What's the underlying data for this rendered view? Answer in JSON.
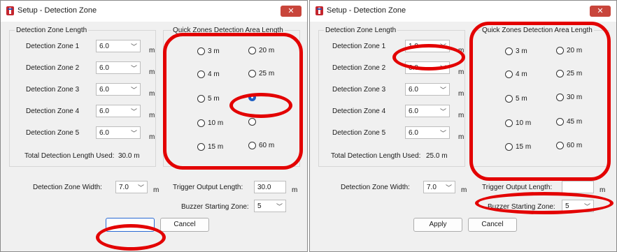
{
  "windows": [
    {
      "title": "Setup - Detection Zone",
      "close_glyph": "✕",
      "length_group": {
        "legend": "Detection Zone Length",
        "zones": [
          {
            "label": "Detection Zone 1",
            "value": "6.0"
          },
          {
            "label": "Detection Zone 2",
            "value": "6.0"
          },
          {
            "label": "Detection Zone 3",
            "value": "6.0"
          },
          {
            "label": "Detection Zone 4",
            "value": "6.0"
          },
          {
            "label": "Detection Zone 5",
            "value": "6.0"
          }
        ],
        "unit": "m",
        "total_label": "Total Detection Length Used:",
        "total_value": "30.0 m"
      },
      "quick_group": {
        "legend": "Quick Zones Detection Area Length",
        "options": [
          "3 m",
          "20 m",
          "4 m",
          "25 m",
          "5 m",
          "",
          "10 m",
          "",
          "15 m",
          "60 m"
        ],
        "checked_index": 5
      },
      "width_label": "Detection Zone Width:",
      "width_value": "7.0",
      "trigger_label": "Trigger Output Length:",
      "trigger_value": "30.0",
      "buzzer_label": "Buzzer Starting Zone:",
      "buzzer_value": "5",
      "apply_label": "",
      "cancel_label": "Cancel",
      "unit": "m"
    },
    {
      "title": "Setup - Detection Zone",
      "close_glyph": "✕",
      "length_group": {
        "legend": "Detection Zone Length",
        "zones": [
          {
            "label": "Detection Zone 1",
            "value": "1.0"
          },
          {
            "label": "Detection Zone 2",
            "value": "6.0"
          },
          {
            "label": "Detection Zone 3",
            "value": "6.0"
          },
          {
            "label": "Detection Zone 4",
            "value": "6.0"
          },
          {
            "label": "Detection Zone 5",
            "value": "6.0"
          }
        ],
        "unit": "m",
        "total_label": "Total Detection Length Used:",
        "total_value": "25.0 m"
      },
      "quick_group": {
        "legend": "Quick Zones Detection Area Length",
        "options": [
          "3 m",
          "20 m",
          "4 m",
          "25 m",
          "5 m",
          "30 m",
          "10 m",
          "45 m",
          "15 m",
          "60 m"
        ],
        "checked_index": -1
      },
      "width_label": "Detection Zone Width:",
      "width_value": "7.0",
      "trigger_label": "Trigger Output Length:",
      "trigger_value": "",
      "buzzer_label": "Buzzer Starting Zone:",
      "buzzer_value": "5",
      "apply_label": "Apply",
      "cancel_label": "Cancel",
      "unit": "m"
    }
  ],
  "annotation_color": "#e30000"
}
